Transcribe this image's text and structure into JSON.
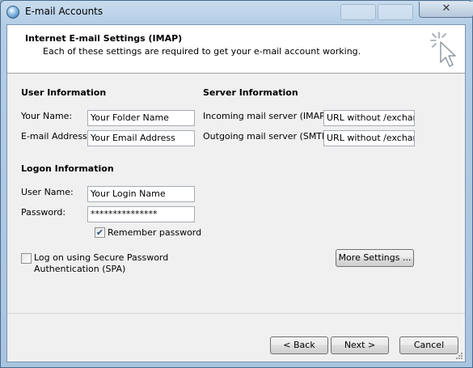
{
  "window": {
    "title": "E-mail Accounts",
    "close_glyph": "✕"
  },
  "header": {
    "title": "Internet E-mail Settings (IMAP)",
    "subtitle": "Each of these settings are required to get your e-mail account working."
  },
  "user_info": {
    "heading": "User Information",
    "name_label": "Your Name:",
    "name_value": "Your Folder Name",
    "email_label": "E-mail Address:",
    "email_value": "Your Email Address"
  },
  "server_info": {
    "heading": "Server Information",
    "incoming_label": "Incoming mail server (IMAP):",
    "incoming_value": "URL without /exchange",
    "outgoing_label": "Outgoing mail server (SMTP):",
    "outgoing_value": "URL without /exchange"
  },
  "logon_info": {
    "heading": "Logon Information",
    "username_label": "User Name:",
    "username_value": "Your Login Name",
    "password_label": "Password:",
    "password_value": "***************",
    "remember_label": "Remember password",
    "remember_checked": true
  },
  "spa": {
    "label_line1": "Log on using Secure Password",
    "label_line2": "Authentication (SPA)",
    "checked": false
  },
  "buttons": {
    "more_settings": "More Settings ...",
    "back": "< Back",
    "next": "Next >",
    "cancel": "Cancel"
  },
  "icons": {
    "app": "globe-icon",
    "header": "cursor-click-icon",
    "checkmark": "✔"
  }
}
